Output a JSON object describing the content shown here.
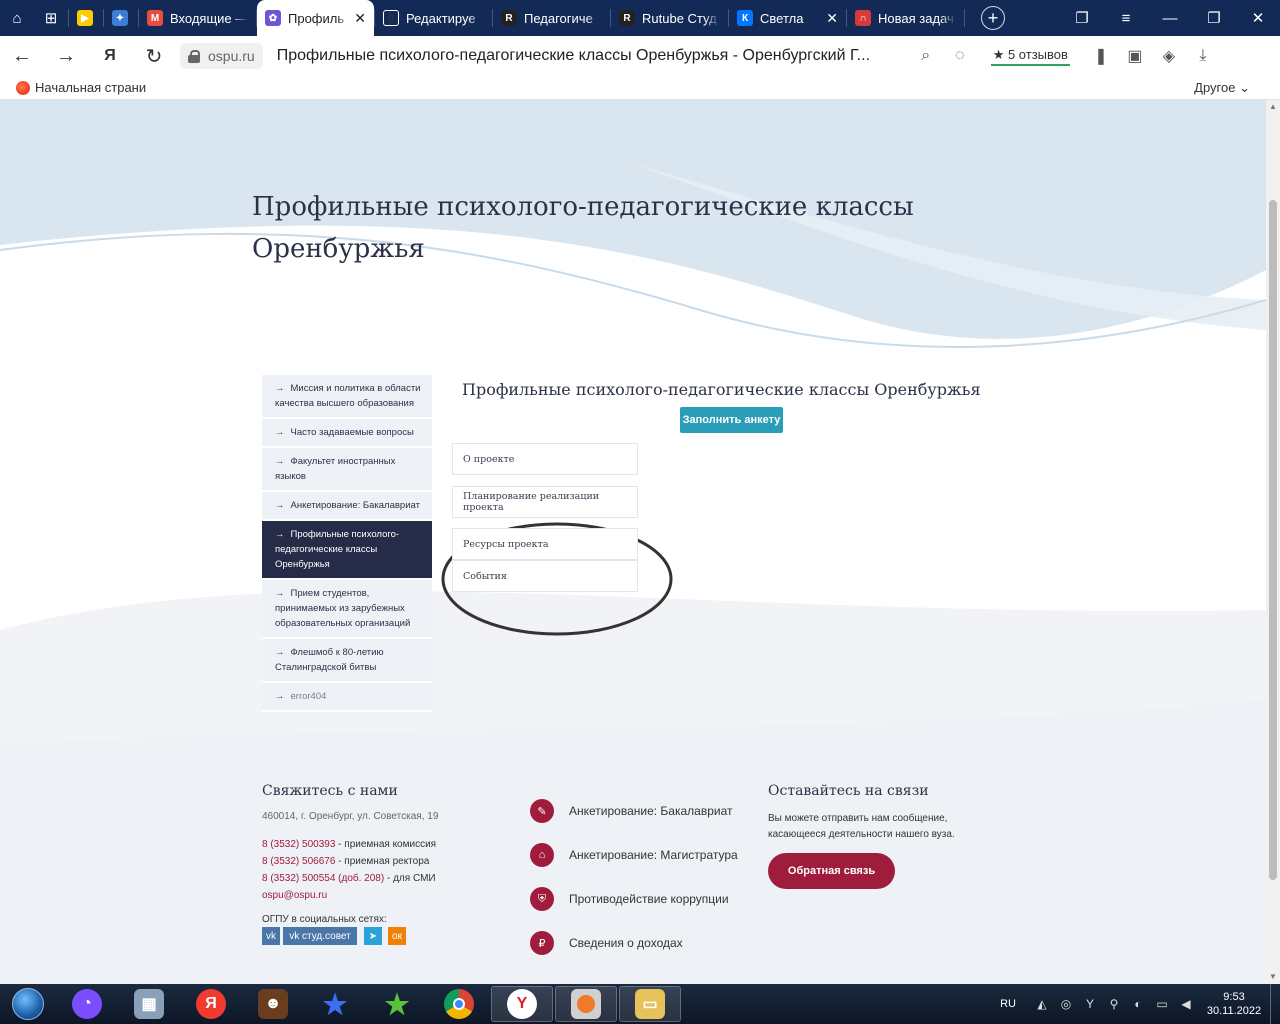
{
  "browser": {
    "tabs": [
      {
        "label": "",
        "color": "#ffcc00",
        "glyph": "▶"
      },
      {
        "label": "",
        "color": "#3d7dd6",
        "glyph": "✦"
      },
      {
        "label": "Входящие —",
        "color": "#e84c3d",
        "glyph": "M"
      },
      {
        "label": "Профиль",
        "color": "#6b57d6",
        "glyph": "✿"
      },
      {
        "label": "Редактируе",
        "color": "#ffffff",
        "glyph": "▯"
      },
      {
        "label": "Педагогиче",
        "color": "#222222",
        "glyph": "R"
      },
      {
        "label": "Rutube Студ",
        "color": "#222222",
        "glyph": "R"
      },
      {
        "label": "Светла",
        "color": "#0077ff",
        "glyph": "К"
      },
      {
        "label": "Новая задач",
        "color": "#d63a3a",
        "glyph": "∩"
      }
    ],
    "domain": "ospu.ru",
    "page_title": "Профильные психолого-педагогические классы Оренбуржья - Оренбургский Г...",
    "reviews": "★ 5 отзывов",
    "bookmark_home": "Начальная страни",
    "bookmark_other": "Другое"
  },
  "page": {
    "hero_title": "Профильные психолого-педагогические классы Оренбуржья",
    "sidebar": [
      {
        "label": "Миссия и политика в области качества высшего образования",
        "state": "normal"
      },
      {
        "label": "Часто задаваемые вопросы",
        "state": "normal"
      },
      {
        "label": "Факультет иностранных языков",
        "state": "normal"
      },
      {
        "label": "Анкетирование: Бакалавриат",
        "state": "normal"
      },
      {
        "label": "Профильные психолого-педагогические классы Оренбуржья",
        "state": "active"
      },
      {
        "label": "Прием студентов, принимаемых из зарубежных образовательных организаций",
        "state": "normal"
      },
      {
        "label": "Флешмоб к 80-летию Сталинградской битвы",
        "state": "normal"
      },
      {
        "label": "error404",
        "state": "muted"
      }
    ],
    "content_title": "Профильные психолого-педагогические классы Оренбуржья",
    "form_button": "Заполнить анкету",
    "project_links": [
      "О проекте",
      "Планирование реализации проекта",
      "Ресурсы проекта",
      "События"
    ]
  },
  "footer": {
    "contact_heading": "Свяжитесь с нами",
    "address": "460014, г. Оренбург, ул. Советская, 19",
    "phones": [
      {
        "number": "8 (3532) 500393",
        "desc": " - приемная комиссия"
      },
      {
        "number": "8 (3532) 506676",
        "desc": " - приемная ректора"
      },
      {
        "number": "8 (3532) 500554 (доб. 208)",
        "desc": " - для СМИ"
      }
    ],
    "email": "ospu@ospu.ru",
    "social_label": "ОГПУ в социальных сетях:",
    "social": [
      "vk",
      "vk студ.совет"
    ],
    "links": [
      "Анкетирование: Бакалавриат",
      "Анкетирование: Магистратура",
      "Противодействие коррупции",
      "Сведения о доходах"
    ],
    "stay_heading": "Оставайтесь на связи",
    "stay_text": "Вы можете отправить нам сообщение, касающееся деятельности нашего вуза.",
    "feedback_button": "Обратная связь"
  },
  "taskbar": {
    "lang": "RU",
    "time": "9:53",
    "date": "30.11.2022"
  },
  "colors": {
    "accent_dark": "#262c47",
    "accent_red": "#a01c3c",
    "accent_teal": "#2a9db8",
    "hero_bg": "#d7e4ee"
  }
}
